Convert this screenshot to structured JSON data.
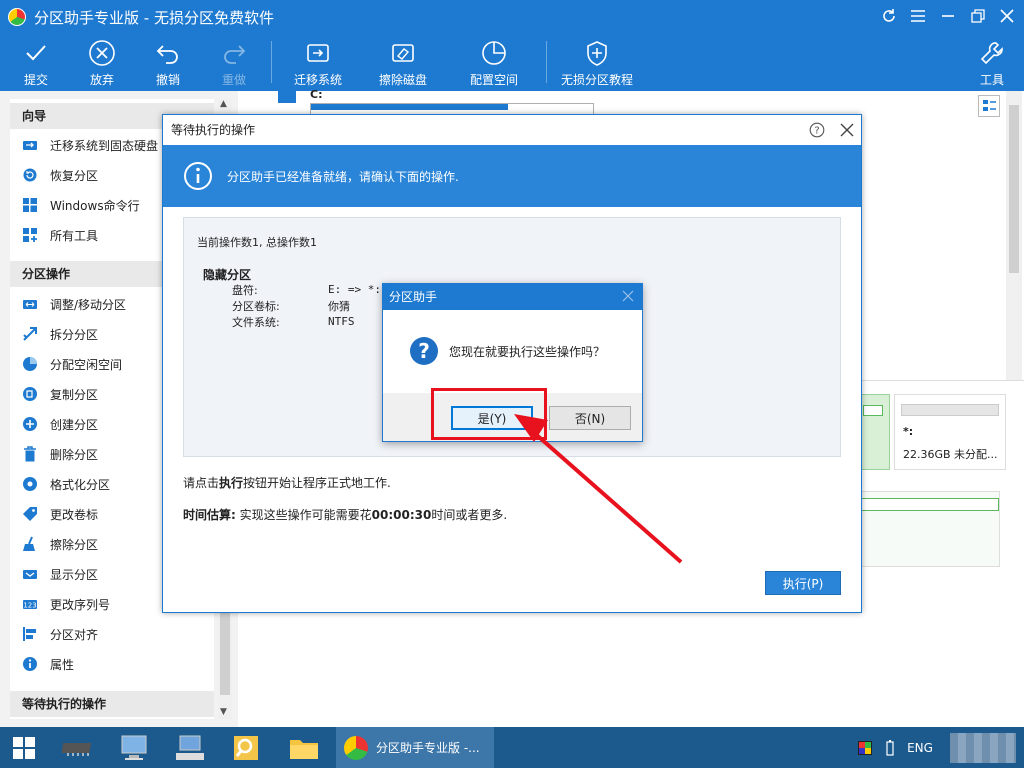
{
  "window": {
    "title": "分区助手专业版 - 无损分区免费软件"
  },
  "toolbar": {
    "commit": "提交",
    "discard": "放弃",
    "undo": "撤销",
    "redo": "重做",
    "migrate_os": "迁移系统",
    "wipe_disk": "擦除磁盘",
    "allocate_space": "配置空间",
    "tutorial": "无损分区教程",
    "tools": "工具"
  },
  "sidebar": {
    "guide_header": "向导",
    "guide_items": [
      "迁移系统到固态硬盘",
      "恢复分区",
      "Windows命令行",
      "所有工具"
    ],
    "partition_header": "分区操作",
    "partition_items": [
      "调整/移动分区",
      "拆分分区",
      "分配空闲空间",
      "复制分区",
      "创建分区",
      "删除分区",
      "格式化分区",
      "更改卷标",
      "擦除分区",
      "显示分区",
      "更改序列号",
      "分区对齐",
      "属性"
    ],
    "pending_header": "等待执行的操作"
  },
  "main": {
    "drive_label": "C:",
    "unallocated_label": "*:",
    "unallocated_size": "22.36GB 未分配..."
  },
  "dialog": {
    "title": "等待执行的操作",
    "banner": "分区助手已经准备就绪，请确认下面的操作.",
    "op_count": "当前操作数1, 总操作数1",
    "op_name": "隐藏分区",
    "op_fields": [
      {
        "key": "盘符:",
        "value": "E: => *:"
      },
      {
        "key": "分区卷标:",
        "value": "你猜"
      },
      {
        "key": "文件系统:",
        "value": "NTFS"
      }
    ],
    "hint_prefix": "请点击",
    "hint_bold": "执行",
    "hint_suffix": "按钮开始让程序正式地工作.",
    "estimate_label": "时间估算:",
    "estimate_prefix": " 实现这些操作可能需要花",
    "estimate_time": "00:00:30",
    "estimate_suffix": "时间或者更多.",
    "execute_button": "执行(P)"
  },
  "confirm": {
    "title": "分区助手",
    "message": "您现在就要执行这些操作吗？",
    "yes_button": "是(Y)",
    "no_button": "否(N)"
  },
  "taskbar": {
    "app_label": "分区助手专业版 -...",
    "lang": "ENG"
  },
  "colors": {
    "accent": "#1e7ad0",
    "banner": "#2a85d8",
    "highlight": "#e8121e",
    "taskbar": "#1c5a8e"
  }
}
